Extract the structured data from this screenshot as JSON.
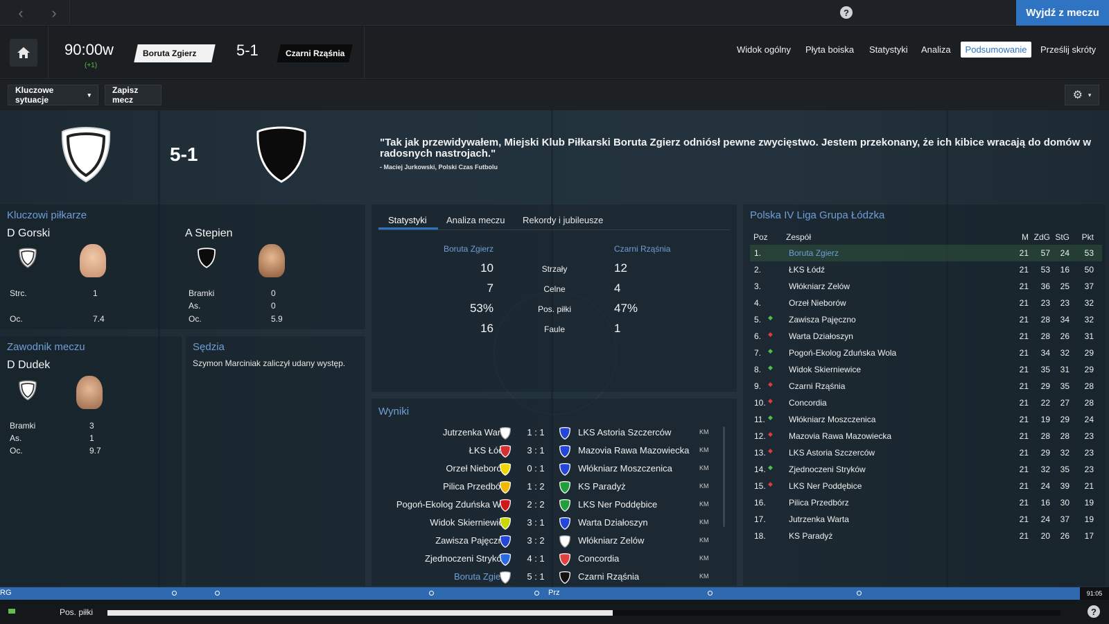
{
  "topbar": {
    "help": "?",
    "leave_label": "Wyjdź z meczu",
    "back": "‹",
    "forward": "›"
  },
  "header": {
    "clock": "90:00w",
    "clock_extra": "(+1)",
    "home_team": "Boruta Zgierz",
    "away_team": "Czarni Rząśnia",
    "score": "5-1",
    "tabs": [
      {
        "label": "Widok ogólny",
        "active": false
      },
      {
        "label": "Płyta boiska",
        "active": false
      },
      {
        "label": "Statystyki",
        "active": false
      },
      {
        "label": "Analiza",
        "active": false
      },
      {
        "label": "Podsumowanie",
        "active": true
      },
      {
        "label": "Prześlij skróty",
        "active": false
      }
    ]
  },
  "toolbar": {
    "key_situations": "Kluczowe sytuacje",
    "save_match": "Zapisz mecz",
    "dropdown_arrow": "▾"
  },
  "summary": {
    "score": "5-1",
    "quote": "\"Tak jak przewidywałem, Miejski Klub Piłkarski Boruta Zgierz odniósł pewne zwycięstwo. Jestem przekonany, że ich kibice wracają do domów w radosnych nastrojach.\"",
    "quote_source": "- Maciej Jurkowski, Polski Czas Futbolu"
  },
  "key_players": {
    "title": "Kluczowi piłkarze",
    "home": {
      "name": "D Gorski",
      "stats": [
        {
          "label": "Strc.",
          "value": "1"
        },
        {
          "label": "Oc.",
          "value": "7.4"
        }
      ]
    },
    "away": {
      "name": "A Stepien",
      "stats": [
        {
          "label": "Bramki",
          "value": "0"
        },
        {
          "label": "As.",
          "value": "0"
        },
        {
          "label": "Oc.",
          "value": "5.9"
        }
      ]
    }
  },
  "motm": {
    "title": "Zawodnik meczu",
    "name": "D Dudek",
    "stats": [
      {
        "label": "Bramki",
        "value": "3"
      },
      {
        "label": "As.",
        "value": "1"
      },
      {
        "label": "Oc.",
        "value": "9.7"
      }
    ]
  },
  "referee": {
    "title": "Sędzia",
    "text": "Szymon Marciniak zaliczył udany występ."
  },
  "stats_panel": {
    "tabs": [
      "Statystyki",
      "Analiza meczu",
      "Rekordy i jubileusze"
    ],
    "home_team": "Boruta Zgierz",
    "away_team": "Czarni Rząśnia",
    "rows": [
      {
        "label": "Strzały",
        "home": "10",
        "away": "12"
      },
      {
        "label": "Celne",
        "home": "7",
        "away": "4"
      },
      {
        "label": "Pos. piłki",
        "home": "53%",
        "away": "47%"
      },
      {
        "label": "Faule",
        "home": "16",
        "away": "1"
      }
    ]
  },
  "results": {
    "title": "Wyniki",
    "rows": [
      {
        "home": "Jutrzenka Warta",
        "score": "1 : 1",
        "away": "LKS Astoria Szczerców",
        "tag": "KM",
        "hc": "#ffffff",
        "ac": "#2446d8",
        "home_hl": false
      },
      {
        "home": "ŁKS Łódź",
        "score": "3 : 1",
        "away": "Mazovia Rawa Mazowiecka",
        "tag": "KM",
        "hc": "#d63030",
        "ac": "#2446d8",
        "home_hl": false
      },
      {
        "home": "Orzeł Nieborów",
        "score": "0 : 1",
        "away": "Włókniarz Moszczenica",
        "tag": "KM",
        "hc": "#f2d600",
        "ac": "#2446d8",
        "home_hl": false
      },
      {
        "home": "Pilica Przedbórz",
        "score": "1 : 2",
        "away": "KS Paradyż",
        "tag": "KM",
        "hc": "#f0b800",
        "ac": "#1f9e3a",
        "home_hl": false
      },
      {
        "home": "Pogoń-Ekolog Zduńska W...",
        "score": "2 : 2",
        "away": "LKS Ner Poddębice",
        "tag": "KM",
        "hc": "#d01818",
        "ac": "#1f9e3a",
        "home_hl": false
      },
      {
        "home": "Widok Skierniewice",
        "score": "3 : 1",
        "away": "Warta Działoszyn",
        "tag": "KM",
        "hc": "#c8d800",
        "ac": "#2446d8",
        "home_hl": false
      },
      {
        "home": "Zawisza Pajęczno",
        "score": "3 : 2",
        "away": "Włókniarz Zelów",
        "tag": "KM",
        "hc": "#2446d8",
        "ac": "#ffffff",
        "home_hl": false
      },
      {
        "home": "Zjednoczeni Stryków",
        "score": "4 : 1",
        "away": "Concordia",
        "tag": "KM",
        "hc": "#2a6ae0",
        "ac": "#e04040",
        "home_hl": false
      },
      {
        "home": "Boruta Zgierz",
        "score": "5 : 1",
        "away": "Czarni Rząśnia",
        "tag": "KM",
        "hc": "#ffffff",
        "ac": "#111111",
        "home_hl": true
      }
    ]
  },
  "league": {
    "title": "Polska IV Liga Grupa Łódzka",
    "headers": {
      "pos": "Poz",
      "team": "Zespół",
      "m": "M",
      "gf": "ZdG",
      "ga": "StG",
      "pts": "Pkt"
    },
    "rows": [
      {
        "pos": "1.",
        "arrow": "",
        "team": "Boruta Zgierz",
        "m": "21",
        "gf": "57",
        "ga": "24",
        "pts": "53",
        "hl": true
      },
      {
        "pos": "2.",
        "arrow": "",
        "team": "ŁKS Łódź",
        "m": "21",
        "gf": "53",
        "ga": "16",
        "pts": "50",
        "hl": false
      },
      {
        "pos": "3.",
        "arrow": "",
        "team": "Włókniarz Zelów",
        "m": "21",
        "gf": "36",
        "ga": "25",
        "pts": "37",
        "hl": false
      },
      {
        "pos": "4.",
        "arrow": "",
        "team": "Orzeł Nieborów",
        "m": "21",
        "gf": "23",
        "ga": "23",
        "pts": "32",
        "hl": false
      },
      {
        "pos": "5.",
        "arrow": "up",
        "team": "Zawisza Pajęczno",
        "m": "21",
        "gf": "28",
        "ga": "34",
        "pts": "32",
        "hl": false
      },
      {
        "pos": "6.",
        "arrow": "down",
        "team": "Warta Działoszyn",
        "m": "21",
        "gf": "28",
        "ga": "26",
        "pts": "31",
        "hl": false
      },
      {
        "pos": "7.",
        "arrow": "up",
        "team": "Pogoń-Ekolog Zduńska Wola",
        "m": "21",
        "gf": "34",
        "ga": "32",
        "pts": "29",
        "hl": false
      },
      {
        "pos": "8.",
        "arrow": "up",
        "team": "Widok Skierniewice",
        "m": "21",
        "gf": "35",
        "ga": "31",
        "pts": "29",
        "hl": false
      },
      {
        "pos": "9.",
        "arrow": "down",
        "team": "Czarni Rząśnia",
        "m": "21",
        "gf": "29",
        "ga": "35",
        "pts": "28",
        "hl": false
      },
      {
        "pos": "10.",
        "arrow": "down",
        "team": "Concordia",
        "m": "21",
        "gf": "22",
        "ga": "27",
        "pts": "28",
        "hl": false
      },
      {
        "pos": "11.",
        "arrow": "up",
        "team": "Włókniarz Moszczenica",
        "m": "21",
        "gf": "19",
        "ga": "29",
        "pts": "24",
        "hl": false
      },
      {
        "pos": "12.",
        "arrow": "down",
        "team": "Mazovia Rawa Mazowiecka",
        "m": "21",
        "gf": "28",
        "ga": "28",
        "pts": "23",
        "hl": false
      },
      {
        "pos": "13.",
        "arrow": "down",
        "team": "LKS Astoria Szczerców",
        "m": "21",
        "gf": "29",
        "ga": "32",
        "pts": "23",
        "hl": false
      },
      {
        "pos": "14.",
        "arrow": "up",
        "team": "Zjednoczeni Stryków",
        "m": "21",
        "gf": "32",
        "ga": "35",
        "pts": "23",
        "hl": false
      },
      {
        "pos": "15.",
        "arrow": "down",
        "team": "LKS Ner Poddębice",
        "m": "21",
        "gf": "24",
        "ga": "39",
        "pts": "21",
        "hl": false
      },
      {
        "pos": "16.",
        "arrow": "",
        "team": "Pilica Przedbórz",
        "m": "21",
        "gf": "16",
        "ga": "30",
        "pts": "19",
        "hl": false
      },
      {
        "pos": "17.",
        "arrow": "",
        "team": "Jutrzenka Warta",
        "m": "21",
        "gf": "24",
        "ga": "37",
        "pts": "19",
        "hl": false
      },
      {
        "pos": "18.",
        "arrow": "",
        "team": "KS Paradyż",
        "m": "21",
        "gf": "20",
        "ga": "26",
        "pts": "17",
        "hl": false
      }
    ]
  },
  "timeline": {
    "left_label": "RG",
    "mid_label": "Prz",
    "time": "91:05"
  },
  "bottom": {
    "possession_label": "Pos. piłki",
    "possession_home_fraction": 0.53,
    "help": "?"
  },
  "colors": {
    "accent": "#2f73c3",
    "link": "#6f9fd8",
    "up": "#4fbf4a",
    "down": "#e03a3a"
  }
}
